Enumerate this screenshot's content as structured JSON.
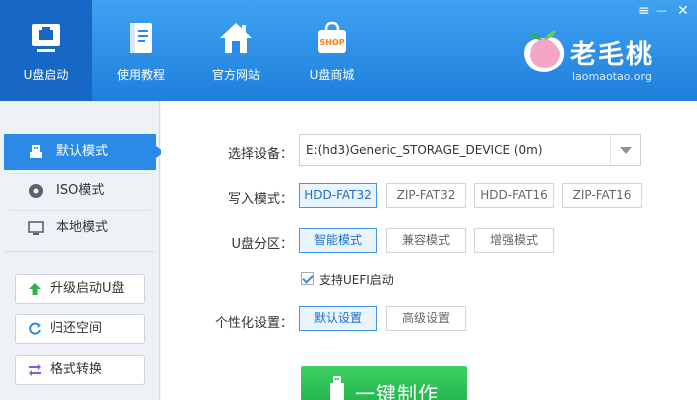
{
  "nav": [
    {
      "label": "U盘启动",
      "icon": "usb-drive-icon"
    },
    {
      "label": "使用教程",
      "icon": "book-icon"
    },
    {
      "label": "官方网站",
      "icon": "home-icon"
    },
    {
      "label": "U盘商城",
      "icon": "shop-bag-icon",
      "badge": "SHOP"
    }
  ],
  "window": {
    "menu_glyph": "≡",
    "minimize_glyph": "—",
    "close_glyph": "✕"
  },
  "brand": {
    "name": "老毛桃",
    "url": "laomaotao.org"
  },
  "modes": [
    {
      "label": "默认模式",
      "icon": "usb-small-icon",
      "active": true
    },
    {
      "label": "ISO模式",
      "icon": "disc-icon",
      "active": false
    },
    {
      "label": "本地模式",
      "icon": "monitor-icon",
      "active": false
    }
  ],
  "tools": [
    {
      "label": "升级启动U盘",
      "icon": "upgrade-arrow-icon"
    },
    {
      "label": "归还空间",
      "icon": "refresh-icon"
    },
    {
      "label": "格式转换",
      "icon": "convert-icon"
    }
  ],
  "device": {
    "label": "选择设备：",
    "value": "E:(hd3)Generic_STORAGE_DEVICE (0m)"
  },
  "write_mode": {
    "label": "写入模式：",
    "options": [
      "HDD-FAT32",
      "ZIP-FAT32",
      "HDD-FAT16",
      "ZIP-FAT16"
    ],
    "selected": 0
  },
  "partition": {
    "label": "U盘分区：",
    "options": [
      "智能模式",
      "兼容模式",
      "增强模式"
    ],
    "selected": 0
  },
  "uefi": {
    "label": "支持UEFI启动",
    "checked": true
  },
  "personalize": {
    "label": "个性化设置：",
    "options": [
      "默认设置",
      "高级设置"
    ],
    "selected": 0
  },
  "action": {
    "label": "一键制作"
  },
  "colors": {
    "header": "#1f7fdc",
    "accent": "#2b8ae6",
    "make_button": "#1fb049"
  }
}
